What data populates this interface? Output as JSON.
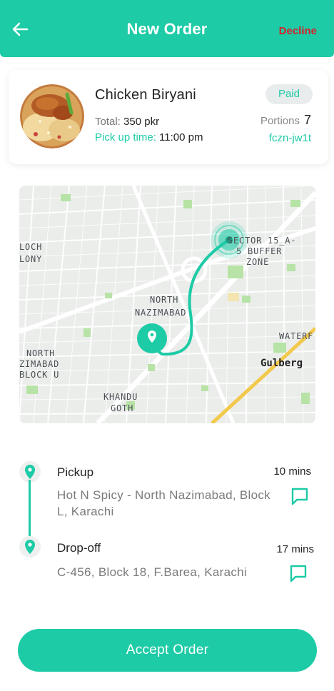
{
  "header": {
    "title": "New Order",
    "decline_label": "Decline"
  },
  "order": {
    "dish_name": "Chicken Biryani",
    "payment_status": "Paid",
    "total_label": "Total:",
    "total_value": "350 pkr",
    "pickup_label": "Pick up time:",
    "pickup_value": "11:00 pm",
    "portions_label": "Portions",
    "portions_value": "7",
    "order_code": "fczn-jw1t"
  },
  "map": {
    "labels": {
      "sector": "SECTOR 15_A-",
      "buffer": "5 BUFFER",
      "zone": "ZONE",
      "loch": "LOCH",
      "lony": "LONY",
      "north1": "NORTH",
      "nazimabad1": "NAZIMABAD",
      "north2": "NORTH",
      "nazimabad2": "ZIMABAD",
      "blocku": "BLOCK U",
      "khandu": "KHANDU",
      "goth": "GOTH",
      "waterf": "WATERF",
      "gulberg": "Gulberg"
    },
    "colors": {
      "route": "#1dcba6",
      "highway": "#f2c94c",
      "park": "#b7e3a6"
    }
  },
  "route": {
    "pickup": {
      "label": "Pickup",
      "eta": "10 mins",
      "address": "Hot N Spicy - North Nazimabad, Block L, Karachi"
    },
    "dropoff": {
      "label": "Drop-off",
      "eta": "17 mins",
      "address": "C-456, Block 18, F.Barea, Karachi"
    }
  },
  "actions": {
    "accept_label": "Accept Order"
  },
  "colors": {
    "accent": "#1dcba6",
    "decline": "#d9202a"
  }
}
